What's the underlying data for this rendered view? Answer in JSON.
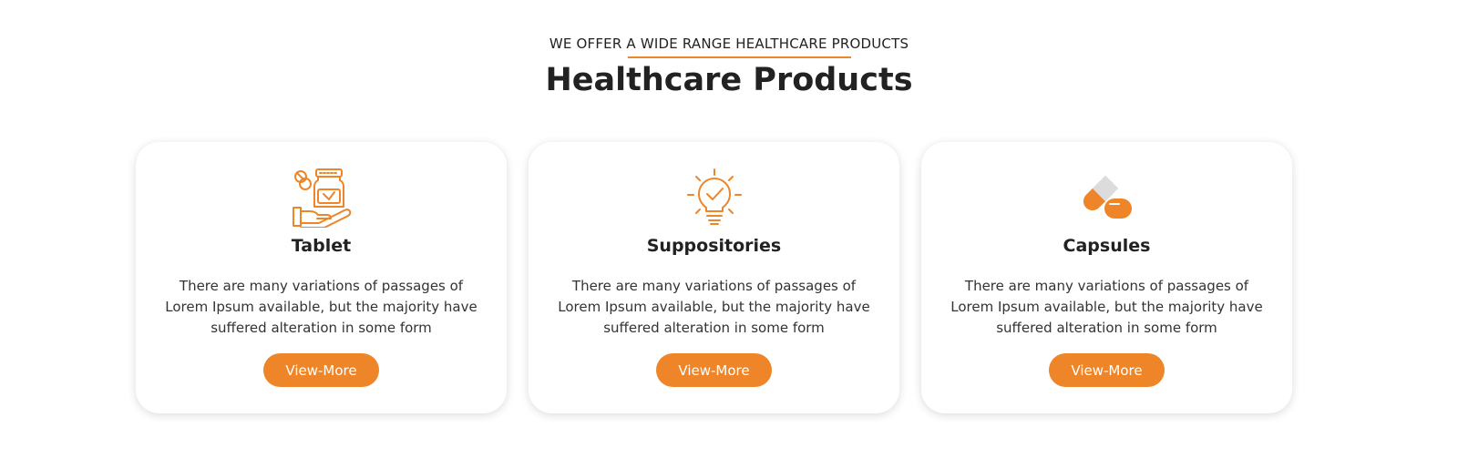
{
  "header": {
    "eyebrow": "WE OFFER A WIDE RANGE HEALTHCARE PRODUCTS",
    "title": "Healthcare Products"
  },
  "accent_color": "#ee8528",
  "cards": [
    {
      "icon": "medicine-bottle-hand-icon",
      "title": "Tablet",
      "description": "There are many variations of passages of Lorem Ipsum available, but the majority have suffered alteration in some form",
      "button_label": "View-More"
    },
    {
      "icon": "lightbulb-check-icon",
      "title": "Suppositories",
      "description": "There are many variations of passages of Lorem Ipsum available, but the majority have suffered alteration in some form",
      "button_label": "View-More"
    },
    {
      "icon": "capsule-icon",
      "title": "Capsules",
      "description": "There are many variations of passages of Lorem Ipsum available, but the majority have suffered alteration in some form",
      "button_label": "View-More"
    }
  ]
}
